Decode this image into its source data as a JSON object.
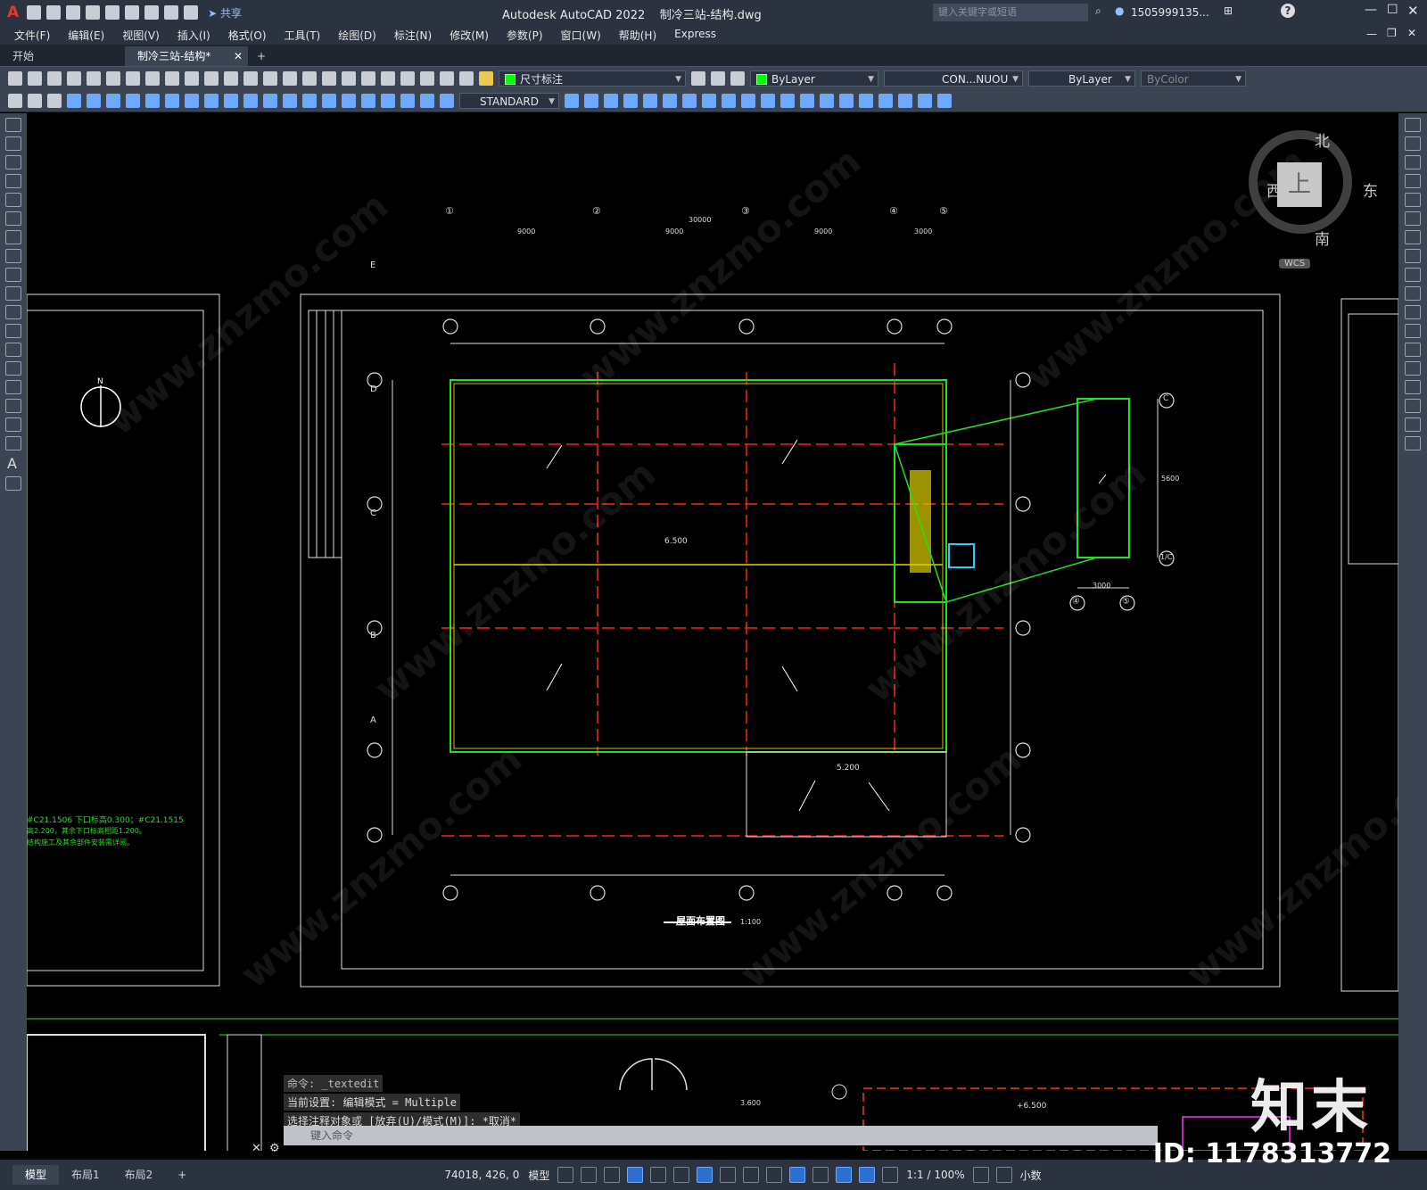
{
  "app": {
    "title": "Autodesk AutoCAD 2022",
    "file": "制冷三站-结构.dwg",
    "share_label": "共享",
    "search_placeholder": "键入关键字或短语",
    "user": "1505999135...",
    "help": "?"
  },
  "menu": [
    "文件(F)",
    "编辑(E)",
    "视图(V)",
    "插入(I)",
    "格式(O)",
    "工具(T)",
    "绘图(D)",
    "标注(N)",
    "修改(M)",
    "参数(P)",
    "窗口(W)",
    "帮助(H)",
    "Express"
  ],
  "tabs": [
    {
      "label": "开始"
    },
    {
      "label": "制冷三站-结构*"
    },
    {
      "label": "+"
    }
  ],
  "toolbar": {
    "layer": "尺寸标注",
    "color": "ByLayer",
    "linetype": "CON...NUOU",
    "lineweight": "ByLayer",
    "plotstyle": "ByColor",
    "textstyle": "STANDARD"
  },
  "viewcube": {
    "north": "北",
    "south": "南",
    "east": "东",
    "west": "西",
    "top": "上",
    "wcs": "WCS"
  },
  "drawing": {
    "axes_top": [
      "①",
      "②",
      "③",
      "④",
      "⑤"
    ],
    "rows": [
      "E",
      "D",
      "C",
      "B",
      "A"
    ],
    "dim_total": "30000",
    "dims": [
      "9000",
      "9000",
      "9000",
      "3000"
    ],
    "elev_main": "6.500",
    "elev_low": "5.200",
    "caption": "屋面布置图",
    "scale": "1:100",
    "left_note_1": "#C21.1506 下口标高0.300；#C21.1515",
    "left_note_2": "高2.200，其余下口标高相距1.200。",
    "left_note_3": "结构施工及其余部件安装需详阅。",
    "north_label": "N",
    "sub_axes": [
      "④",
      "⑤"
    ],
    "sub_dim": "3000",
    "sub_rows": [
      "C",
      "1/C"
    ],
    "sub_dim_v": "5600",
    "elev_bottom": "+6.500",
    "elev_bottom2": "3.600"
  },
  "command": {
    "line1": "命令: _textedit",
    "line2": "当前设置: 编辑模式 = Multiple",
    "line3": "选择注释对象或 [放弃(U)/模式(M)]: *取消*",
    "placeholder": "键入命令"
  },
  "layout_tabs": [
    "模型",
    "布局1",
    "布局2",
    "+"
  ],
  "status": {
    "coords": "74018, 426, 0",
    "model": "模型",
    "scale": "1:1 / 100%",
    "units": "小数"
  },
  "watermark": {
    "brand": "知末",
    "id": "ID: 1178313772",
    "url": "www.znzmo.com"
  }
}
